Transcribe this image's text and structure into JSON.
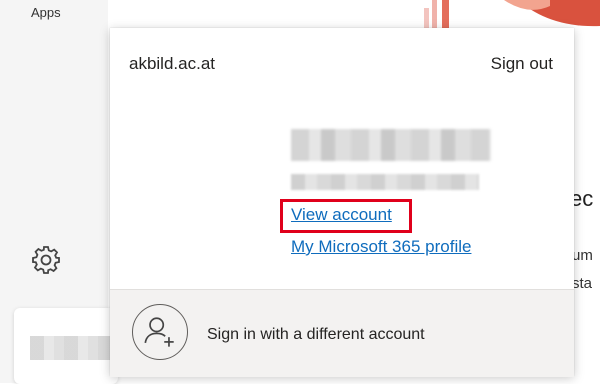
{
  "background": {
    "apps_label": "Apps",
    "right_heading_fragment": "ec",
    "right_line_1": "um",
    "right_line_2": "sta"
  },
  "account_popup": {
    "organization": "akbild.ac.at",
    "sign_out_label": "Sign out",
    "view_account_label": "View account",
    "profile_link_label": "My Microsoft 365 profile",
    "different_account_label": "Sign in with a different account"
  },
  "colors": {
    "link": "#0f6cbd",
    "highlight": "#e0001b"
  },
  "icons": {
    "settings": "gear-icon",
    "add_account": "person-add-icon"
  }
}
